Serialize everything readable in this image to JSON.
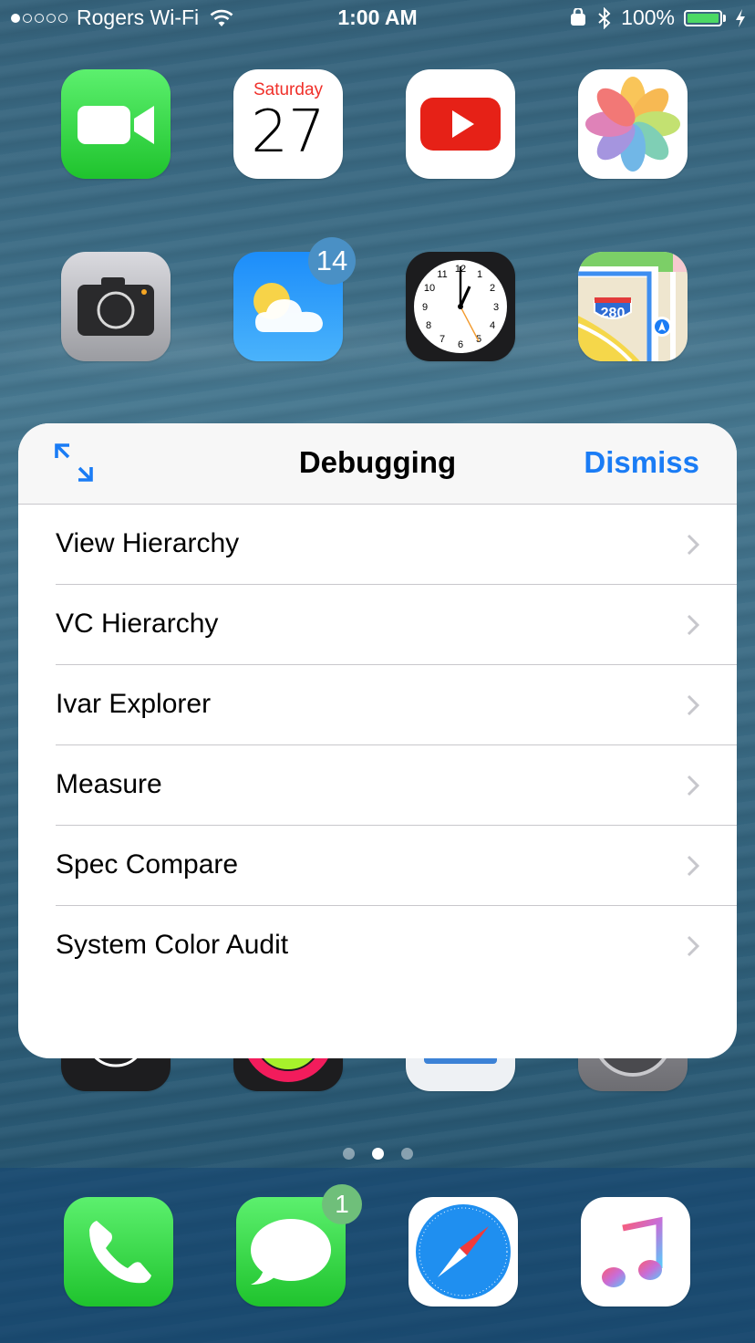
{
  "status_bar": {
    "carrier": "Rogers Wi-Fi",
    "time": "1:00 AM",
    "battery_percent": "100%",
    "battery_level": 1.0,
    "signal_bars_filled": 1,
    "signal_bars_total": 5
  },
  "home": {
    "calendar": {
      "weekday": "Saturday",
      "day": "27"
    },
    "weather_badge": "14",
    "maps_shield": "280",
    "messages_badge": "1",
    "page_indicator": {
      "count": 3,
      "active": 2
    }
  },
  "sheet": {
    "title": "Debugging",
    "dismiss_label": "Dismiss",
    "items": [
      {
        "label": "View Hierarchy"
      },
      {
        "label": "VC Hierarchy"
      },
      {
        "label": "Ivar Explorer"
      },
      {
        "label": "Measure"
      },
      {
        "label": "Spec Compare"
      },
      {
        "label": "System Color Audit"
      }
    ]
  },
  "colors": {
    "accent": "#1a7cf5",
    "battery_green": "#4cd964",
    "separator": "#c8c7cc"
  },
  "icons": [
    "facetime-icon",
    "calendar-icon",
    "youtube-icon",
    "photos-icon",
    "camera-icon",
    "weather-icon",
    "clock-icon",
    "maps-icon",
    "phone-icon",
    "messages-icon",
    "safari-icon",
    "music-icon"
  ]
}
